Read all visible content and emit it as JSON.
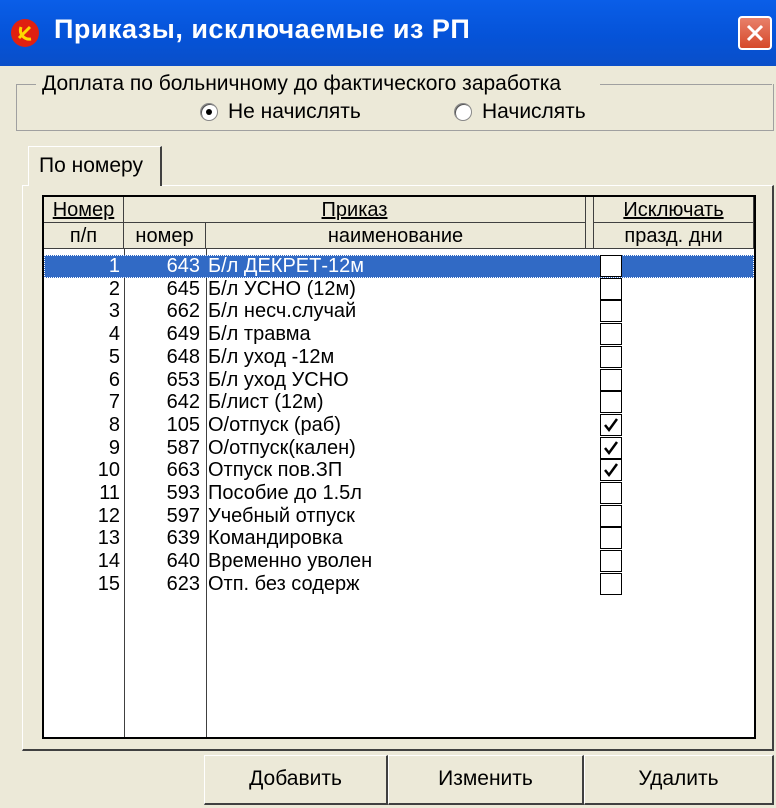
{
  "window": {
    "title": "Приказы, исключаемые из РП"
  },
  "sick_pay": {
    "group_label": "Доплата по больничному до фактического заработка",
    "options": [
      {
        "label": "Не начислять",
        "checked": true
      },
      {
        "label": "Начислять",
        "checked": false
      }
    ]
  },
  "tabs": [
    {
      "label": "По номеру"
    }
  ],
  "table": {
    "headers": {
      "num_top": "Номер",
      "num_bottom": "п/п",
      "order_group": "Приказ",
      "order_code": "номер",
      "order_name": "наименование",
      "exclude_top": "Исключать",
      "exclude_bottom": "празд. дни"
    },
    "rows": [
      {
        "n": "1",
        "code": "643",
        "name": "Б/л ДЕКРЕТ-12м",
        "checked": false,
        "selected": true
      },
      {
        "n": "2",
        "code": "645",
        "name": "Б/л УСНО (12м)",
        "checked": false
      },
      {
        "n": "3",
        "code": "662",
        "name": "Б/л несч.случай",
        "checked": false
      },
      {
        "n": "4",
        "code": "649",
        "name": "Б/л травма",
        "checked": false
      },
      {
        "n": "5",
        "code": "648",
        "name": "Б/л уход -12м",
        "checked": false
      },
      {
        "n": "6",
        "code": "653",
        "name": "Б/л уход УСНО",
        "checked": false
      },
      {
        "n": "7",
        "code": "642",
        "name": "Б/лист (12м)",
        "checked": false
      },
      {
        "n": "8",
        "code": "105",
        "name": "О/отпуск  (раб)",
        "checked": true
      },
      {
        "n": "9",
        "code": "587",
        "name": "О/отпуск(кален)",
        "checked": true
      },
      {
        "n": "10",
        "code": "663",
        "name": "Отпуск пов.ЗП",
        "checked": true
      },
      {
        "n": "11",
        "code": "593",
        "name": "Пособие до 1.5л",
        "checked": false
      },
      {
        "n": "12",
        "code": "597",
        "name": "Учебный отпуск",
        "checked": false
      },
      {
        "n": "13",
        "code": "639",
        "name": "Командировка",
        "checked": false
      },
      {
        "n": "14",
        "code": "640",
        "name": "Временно уволен",
        "checked": false
      },
      {
        "n": "15",
        "code": "623",
        "name": "Отп. без содерж",
        "checked": false
      }
    ]
  },
  "buttons": {
    "add": "Добавить",
    "edit": "Изменить",
    "delete": "Удалить"
  }
}
